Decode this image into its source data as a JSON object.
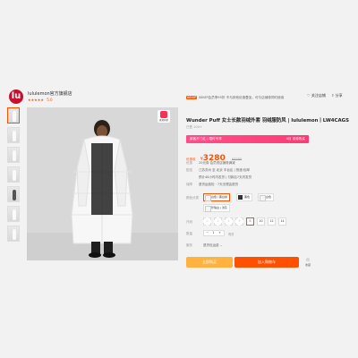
{
  "store": {
    "logo_glyph": "lu",
    "name": "lululemon官方旗舰店",
    "stars": "★★★★★",
    "rating": "5.0",
    "follow_label": "关注店铺",
    "share_label": "分享"
  },
  "promo": {
    "tag": "88VIP",
    "text": "88VIP会员享95折 不与其他优惠叠加，可与店铺券同时使用"
  },
  "badge": {
    "label": "逛逛同款"
  },
  "product": {
    "title": "Wunder Puff 女士长款羽绒外套 羽绒服防风 | lululemon丨LW4CAGS",
    "sold": "已售 100+",
    "member_left": "新客开门红 | 限时专享",
    "member_right": "4月 领券购买",
    "price_label": "优惠前",
    "currency": "¥",
    "price": "3280",
    "orig_price": "¥3280",
    "rows": [
      {
        "label": "优惠",
        "value": "20元券   会员领店铺券满减"
      },
      {
        "label": "配送",
        "value": "江苏苏州 至 北京 丰台区 | 快递:包邮"
      },
      {
        "label": "",
        "value": "预计48小时内发货 | 付款后7天内发货"
      },
      {
        "label": "保障",
        "value": "退货运费险 · 7天无理由退货"
      }
    ],
    "color_label": "颜色分类",
    "colors": [
      "白色 | 黑白拼",
      "黑色",
      "白色",
      "珍珠白 | 浅灰"
    ],
    "size_label": "尺码",
    "sizes": [
      "0",
      "2",
      "4",
      "6",
      "8",
      "10",
      "12",
      "14"
    ],
    "selected_size": "8",
    "qty_label": "数量",
    "qty": {
      "minus": "−",
      "value": "1",
      "plus": "+"
    },
    "stock": "有货",
    "svc_label": "服务",
    "svc_value": "退货包运费 ⌄",
    "buy_label": "立即购买",
    "cart_label": "加入购物车",
    "fav_icon": "☆",
    "fav_label": "收藏"
  },
  "colors": {
    "accent": "#ff5000",
    "buy": "#ffb23f",
    "member": "#ff4e8b",
    "logo": "#c8102e"
  }
}
